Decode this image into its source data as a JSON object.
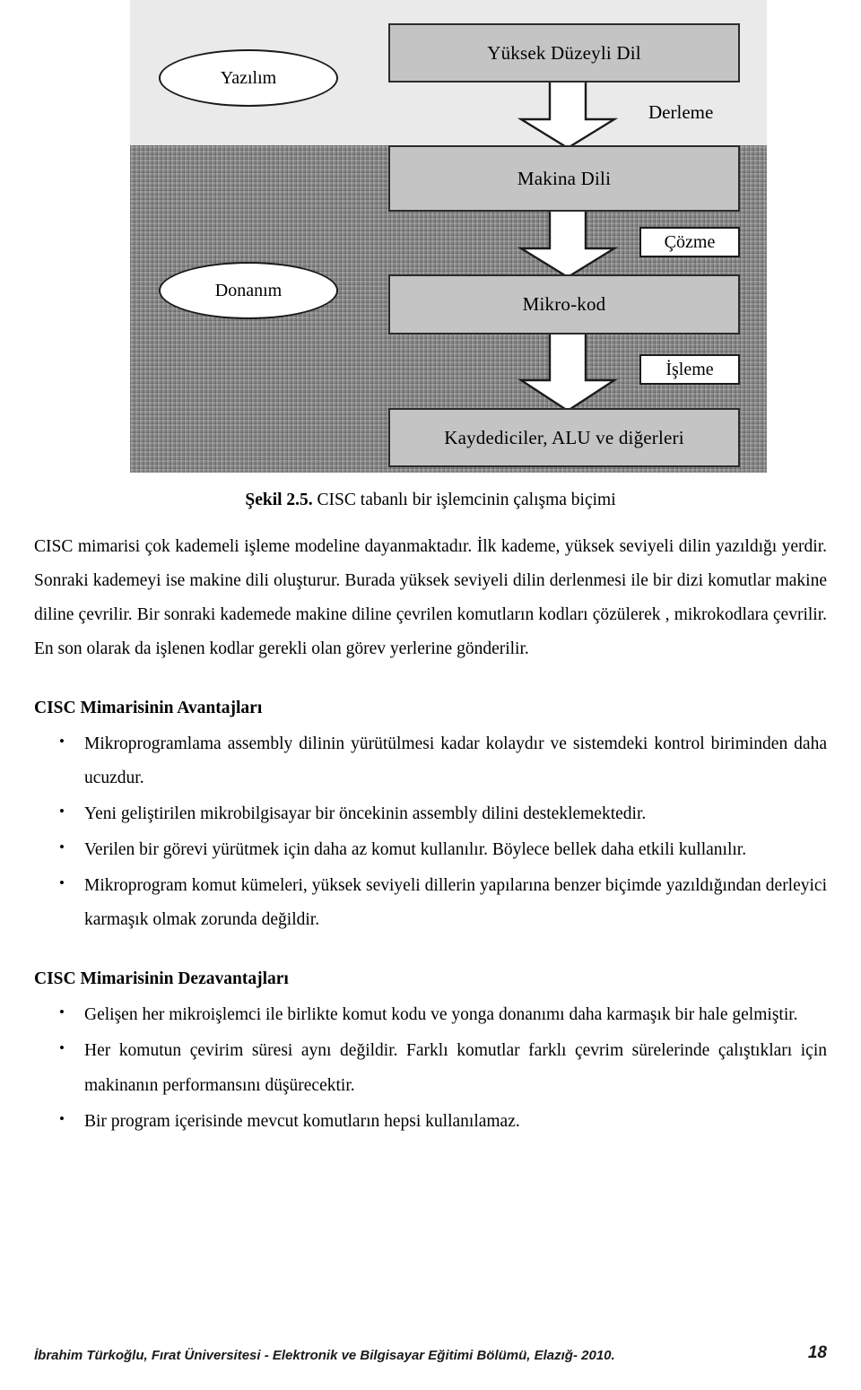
{
  "figure": {
    "caption_number": "Şekil 2.5.",
    "caption_text": "CISC tabanlı bir işlemcinin çalışma biçimi",
    "bands": {
      "top_label": "software-layer",
      "bottom_label": "hardware-layer"
    },
    "ellipses": [
      {
        "id": "yazilim",
        "label": "Yazılım"
      },
      {
        "id": "donanim",
        "label": "Donanım"
      }
    ],
    "stages": [
      {
        "id": "yuksek-duzeyli-dil",
        "label": "Yüksek Düzeyli Dil"
      },
      {
        "id": "makina-dili",
        "label": "Makina Dili"
      },
      {
        "id": "mikro-kod",
        "label": "Mikro-kod"
      },
      {
        "id": "kaydediciler",
        "label": "Kaydediciler, ALU ve diğerleri"
      }
    ],
    "transitions": [
      {
        "id": "derleme",
        "label": "Derleme",
        "boxed": false
      },
      {
        "id": "cozme",
        "label": "Çözme",
        "boxed": true
      },
      {
        "id": "isleme",
        "label": "İşleme",
        "boxed": true
      }
    ],
    "colors": {
      "stage_fill": "#c4c4c4",
      "stage_border": "#2b2b2b",
      "band_top": "#eaeaea",
      "band_bottom": "#8d8d8d",
      "arrow_fill": "#ffffff"
    }
  },
  "body": {
    "paragraph_1": "CISC mimarisi çok kademeli işleme modeline dayanmaktadır. İlk kademe, yüksek seviyeli dilin yazıldığı yerdir. Sonraki kademeyi ise makine dili oluşturur. Burada yüksek   seviyeli dilin derlenmesi ile bir dizi komutlar makine diline çevrilir. Bir sonraki kademede makine diline çevrilen komutların kodları çözülerek , mikrokodlara çevrilir. En son olarak da işlenen kodlar gerekli olan görev yerlerine gönderilir."
  },
  "advantages": {
    "heading": "CISC Mimarisinin Avantajları",
    "items": [
      "Mikroprogramlama assembly dilinin yürütülmesi kadar kolaydır ve sistemdeki kontrol biriminden daha ucuzdur.",
      "Yeni geliştirilen mikrobilgisayar bir öncekinin assembly dilini desteklemektedir.",
      "Verilen bir görevi yürütmek için daha az komut kullanılır. Böylece bellek daha etkili kullanılır.",
      "Mikroprogram komut kümeleri, yüksek seviyeli dillerin yapılarına benzer biçimde yazıldığından derleyici karmaşık olmak zorunda değildir."
    ]
  },
  "disadvantages": {
    "heading": "CISC Mimarisinin Dezavantajları",
    "items": [
      "Gelişen her mikroişlemci ile birlikte komut kodu ve yonga donanımı daha karmaşık bir hale gelmiştir.",
      "Her komutun  çevirim süresi aynı değildir. Farklı komutlar farklı çevrim sürelerinde çalıştıkları için makinanın performansını düşürecektir.",
      "Bir program içerisinde mevcut komutların hepsi kullanılamaz."
    ]
  },
  "footer": {
    "text": "İbrahim Türkoğlu, Fırat Üniversitesi - Elektronik ve Bilgisayar Eğitimi Bölümü, Elazığ- 2010.",
    "page_number": "18"
  }
}
